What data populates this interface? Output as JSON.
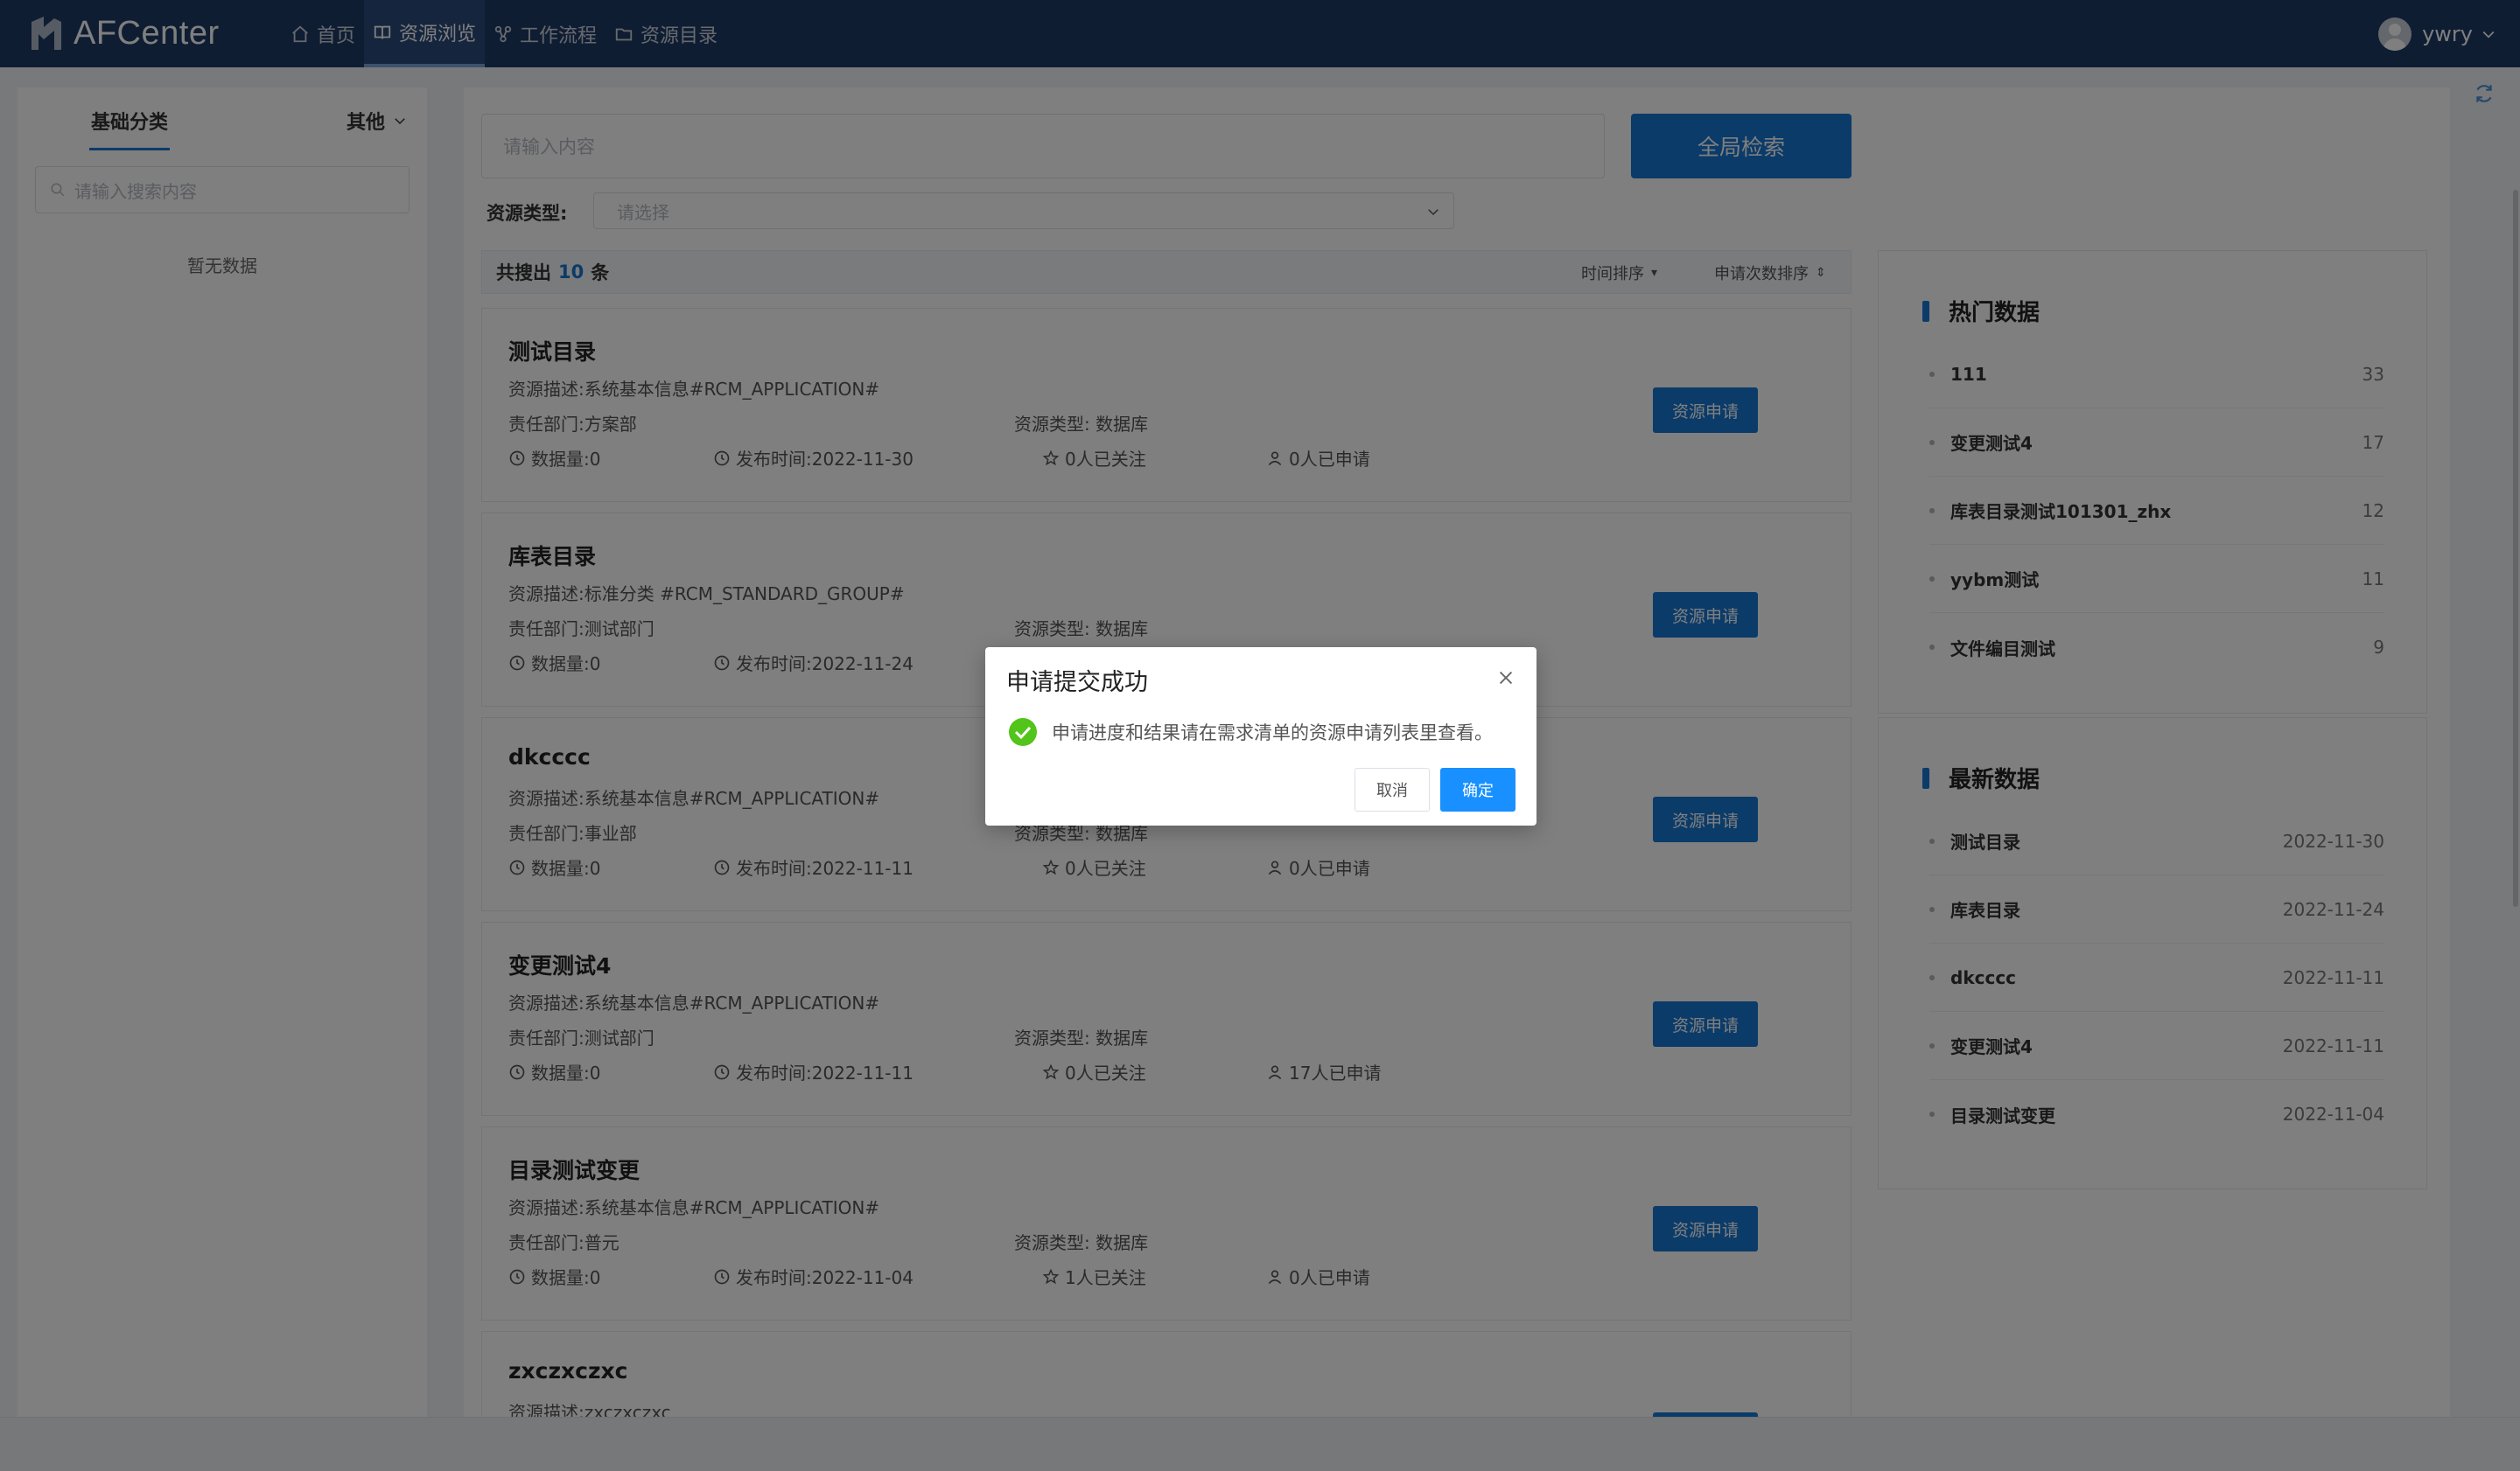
{
  "header": {
    "logo_text": "AFCenter",
    "nav": [
      {
        "label": "首页",
        "icon": "home-icon"
      },
      {
        "label": "资源浏览",
        "icon": "book-icon",
        "active": true
      },
      {
        "label": "工作流程",
        "icon": "workflow-icon"
      },
      {
        "label": "资源目录",
        "icon": "folder-icon"
      }
    ],
    "user": "ywry"
  },
  "sidebar": {
    "tab_basic": "基础分类",
    "tab_other": "其他",
    "search_placeholder": "请输入搜索内容",
    "empty_text": "暂无数据"
  },
  "search": {
    "placeholder": "请输入内容",
    "button": "全局检索",
    "type_label": "资源类型:",
    "type_placeholder": "请选择"
  },
  "results": {
    "prefix": "共搜出",
    "count": "10",
    "suffix": "条",
    "sort_time": "时间排序",
    "sort_apply": "申请次数排序",
    "apply_button": "资源申请",
    "items": [
      {
        "title": "测试目录",
        "desc": "资源描述:系统基本信息#RCM_APPLICATION#",
        "dept": "责任部门:方案部",
        "type": "资源类型: 数据库",
        "amount": "数据量:0",
        "date": "发布时间:2022-11-30",
        "follow": "0人已关注",
        "applied": "0人已申请"
      },
      {
        "title": "库表目录",
        "desc": "资源描述:标准分类 #RCM_STANDARD_GROUP#",
        "dept": "责任部门:测试部门",
        "type": "资源类型: 数据库",
        "amount": "数据量:0",
        "date": "发布时间:2022-11-24",
        "follow": "",
        "applied": ""
      },
      {
        "title": "dkcccc",
        "desc": "资源描述:系统基本信息#RCM_APPLICATION#",
        "dept": "责任部门:事业部",
        "type": "资源类型: 数据库",
        "amount": "数据量:0",
        "date": "发布时间:2022-11-11",
        "follow": "0人已关注",
        "applied": "0人已申请"
      },
      {
        "title": "变更测试4",
        "desc": "资源描述:系统基本信息#RCM_APPLICATION#",
        "dept": "责任部门:测试部门",
        "type": "资源类型: 数据库",
        "amount": "数据量:0",
        "date": "发布时间:2022-11-11",
        "follow": "0人已关注",
        "applied": "17人已申请"
      },
      {
        "title": "目录测试变更",
        "desc": "资源描述:系统基本信息#RCM_APPLICATION#",
        "dept": "责任部门:普元",
        "type": "资源类型: 数据库",
        "amount": "数据量:0",
        "date": "发布时间:2022-11-04",
        "follow": "1人已关注",
        "applied": "0人已申请"
      },
      {
        "title": "zxczxczxc",
        "desc": "资源描述:zxczxczxc",
        "dept": "",
        "type": "",
        "amount": "",
        "date": "",
        "follow": "",
        "applied": ""
      }
    ]
  },
  "hot": {
    "title": "热门数据",
    "items": [
      {
        "name": "111",
        "value": "33"
      },
      {
        "name": "变更测试4",
        "value": "17"
      },
      {
        "name": "库表目录测试101301_zhx",
        "value": "12"
      },
      {
        "name": "yybm测试",
        "value": "11"
      },
      {
        "name": "文件编目测试",
        "value": "9"
      }
    ]
  },
  "latest": {
    "title": "最新数据",
    "items": [
      {
        "name": "测试目录",
        "value": "2022-11-30"
      },
      {
        "name": "库表目录",
        "value": "2022-11-24"
      },
      {
        "name": "dkcccc",
        "value": "2022-11-11"
      },
      {
        "name": "变更测试4",
        "value": "2022-11-11"
      },
      {
        "name": "目录测试变更",
        "value": "2022-11-04"
      }
    ]
  },
  "modal": {
    "title": "申请提交成功",
    "message": "申请进度和结果请在需求清单的资源申请列表里查看。",
    "cancel": "取消",
    "ok": "确定"
  },
  "colors": {
    "header": "#1e3a66",
    "primary": "#1677d2",
    "success": "#52c41a"
  }
}
